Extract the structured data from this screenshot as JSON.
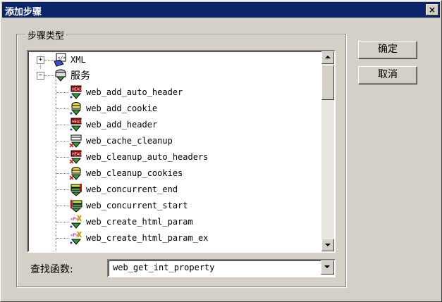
{
  "window": {
    "title": "添加步骤",
    "close_glyph": "×"
  },
  "group": {
    "label": "步骤类型"
  },
  "tree": {
    "categories": [
      {
        "label": "XML",
        "expander": "+",
        "icon": "xml-folder-icon"
      },
      {
        "label": "服务",
        "expander": "−",
        "icon": "service-folder-icon"
      }
    ],
    "items": [
      {
        "label": "web_add_auto_header",
        "icon": "head-icon"
      },
      {
        "label": "web_add_cookie",
        "icon": "cookie-icon"
      },
      {
        "label": "web_add_header",
        "icon": "head-icon"
      },
      {
        "label": "web_cache_cleanup",
        "icon": "cache-icon"
      },
      {
        "label": "web_cleanup_auto_headers",
        "icon": "head-cleanup-icon"
      },
      {
        "label": "web_cleanup_cookies",
        "icon": "cookie-cleanup-icon"
      },
      {
        "label": "web_concurrent_end",
        "icon": "concurrent-end-icon"
      },
      {
        "label": "web_concurrent_start",
        "icon": "concurrent-start-icon"
      },
      {
        "label": "web_create_html_param",
        "icon": "param-icon"
      },
      {
        "label": "web_create_html_param_ex",
        "icon": "param-icon"
      }
    ]
  },
  "find": {
    "label": "查找函数:",
    "value": "web_get_int_property"
  },
  "buttons": {
    "ok": "确定",
    "cancel": "取消"
  },
  "colors": {
    "titlebar": "#0a246a",
    "face": "#d4d0c8"
  }
}
